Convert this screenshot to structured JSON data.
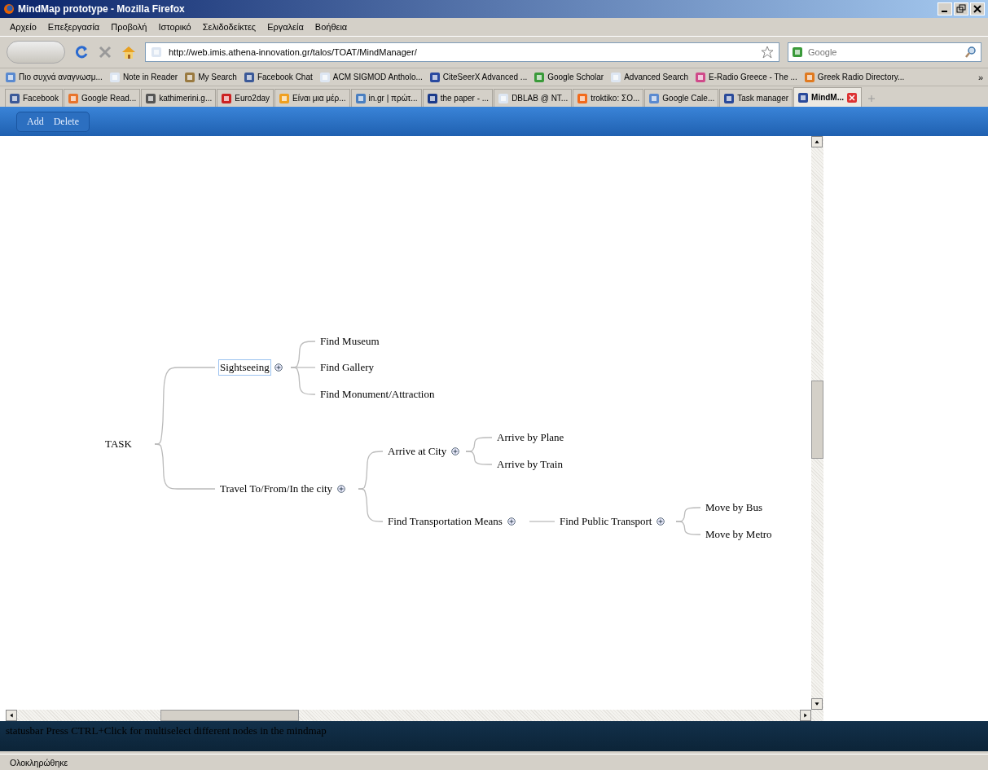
{
  "window": {
    "title": "MindMap prototype - Mozilla Firefox"
  },
  "menu": [
    "Αρχείο",
    "Επεξεργασία",
    "Προβολή",
    "Ιστορικό",
    "Σελιδοδείκτες",
    "Εργαλεία",
    "Βοήθεια"
  ],
  "address_bar": {
    "value": "http://web.imis.athena-innovation.gr/talos/TOAT/MindManager/"
  },
  "search_field": {
    "placeholder": "Google"
  },
  "bookmarks": [
    "Πιο συχνά αναγνωσμ...",
    "Note in Reader",
    "My Search",
    "Facebook Chat",
    "ACM SIGMOD Antholo...",
    "CiteSeerX Advanced ...",
    "Google Scholar",
    "Advanced Search",
    "E-Radio Greece - The ...",
    "Greek Radio Directory..."
  ],
  "bookmarks_overflow": "»",
  "tabs": [
    {
      "label": "Facebook",
      "selected": false
    },
    {
      "label": "Google Read...",
      "selected": false
    },
    {
      "label": "kathimerini.g...",
      "selected": false
    },
    {
      "label": "Euro2day",
      "selected": false
    },
    {
      "label": "Είναι μια μέρ...",
      "selected": false
    },
    {
      "label": "in.gr | πρώτ...",
      "selected": false
    },
    {
      "label": "the paper - ...",
      "selected": false
    },
    {
      "label": "DBLAB @ NT...",
      "selected": false
    },
    {
      "label": "troktiko: ΣΟ...",
      "selected": false
    },
    {
      "label": "Google Cale...",
      "selected": false
    },
    {
      "label": "Task manager",
      "selected": false
    },
    {
      "label": "MindM...",
      "selected": true
    }
  ],
  "toolbar": {
    "buttons": [
      "Add",
      "Delete"
    ]
  },
  "mindmap": {
    "root": {
      "label": "TASK",
      "selected": false,
      "children": [
        {
          "label": "Sightseeing",
          "selected": true,
          "children": [
            {
              "label": "Find Museum",
              "selected": false
            },
            {
              "label": "Find Gallery",
              "selected": false
            },
            {
              "label": "Find Monument/Attraction",
              "selected": false
            }
          ]
        },
        {
          "label": "Travel To/From/In the city",
          "selected": false,
          "children": [
            {
              "label": "Arrive at City",
              "selected": false,
              "children": [
                {
                  "label": "Arrive by Plane",
                  "selected": false
                },
                {
                  "label": "Arrive by Train",
                  "selected": false
                }
              ]
            },
            {
              "label": "Find Transportation Means",
              "selected": false,
              "children": [
                {
                  "label": "Find Public Transport",
                  "selected": false,
                  "children": [
                    {
                      "label": "Move by Bus",
                      "selected": false
                    },
                    {
                      "label": "Move by Metro",
                      "selected": false
                    }
                  ]
                }
              ]
            }
          ]
        }
      ]
    }
  },
  "statusbar": {
    "text": "statusbar Press CTRL+Click for multiselect different nodes in the mindmap"
  },
  "browser_status": "Ολοκληρώθηκε"
}
